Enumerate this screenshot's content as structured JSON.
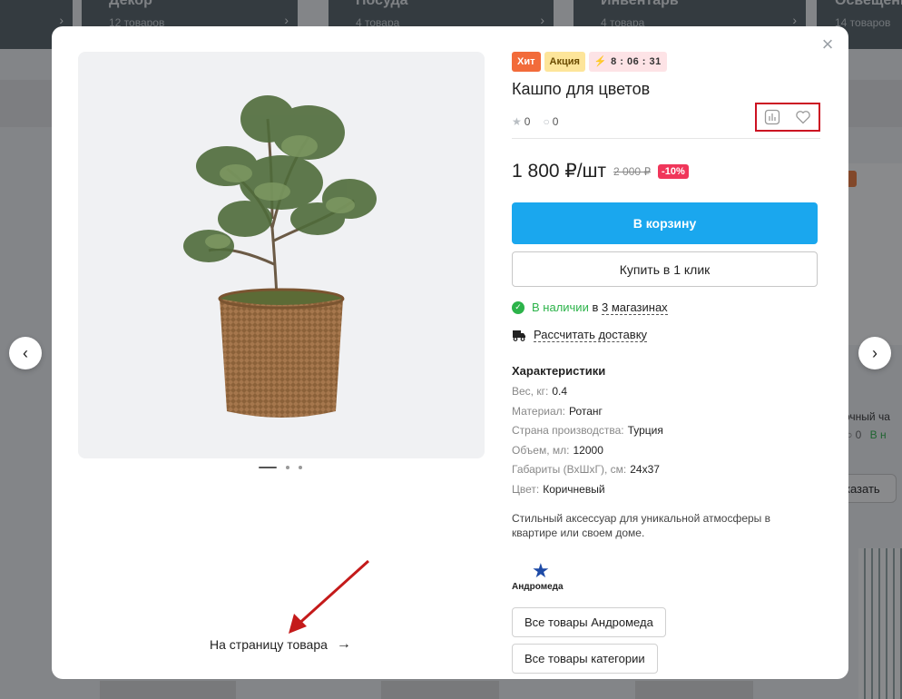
{
  "background": {
    "categories": [
      {
        "name": "Декор",
        "count": "12 товаров"
      },
      {
        "name": "Посуда",
        "count": "4 товара"
      },
      {
        "name": "Инвентарь",
        "count": "4 товара"
      },
      {
        "name": "Освещени",
        "count": "14 товаров"
      }
    ],
    "right_card_title": "очный ча",
    "right_card_rating": "0",
    "right_card_stock": "В н",
    "right_card_button": "казать"
  },
  "nav": {
    "prev_icon": "‹",
    "next_icon": "›"
  },
  "modal": {
    "close_icon": "×",
    "gallery": {
      "image_alt": "Кашпо для цветов",
      "dots_count": 3
    },
    "to_product": {
      "label": "На страницу товара",
      "arrow": "→"
    },
    "badges": {
      "hit": "Хит",
      "promo": "Акция",
      "timer": "8 : 06 : 31"
    },
    "title": "Кашпо для цветов",
    "rating": "0",
    "reviews": "0",
    "price": "1 800 ₽/шт",
    "old_price": "2 000 ₽",
    "discount": "-10%",
    "cart_button": "В корзину",
    "oneclick_button": "Купить в 1 клик",
    "stock": {
      "available": "В наличии",
      "in": "в",
      "stores": "3 магазинах"
    },
    "delivery": "Рассчитать доставку",
    "chars_title": "Характеристики",
    "chars": [
      {
        "k": "Вес, кг:",
        "v": "0.4"
      },
      {
        "k": "Материал:",
        "v": "Ротанг"
      },
      {
        "k": "Страна производства:",
        "v": "Турция"
      },
      {
        "k": "Объем, мл:",
        "v": "12000"
      },
      {
        "k": "Габариты (ВхШхГ), см:",
        "v": "24х37"
      },
      {
        "k": "Цвет:",
        "v": "Коричневый"
      }
    ],
    "description": "Стильный аксессуар для уникальной атмосферы в квартире или своем доме.",
    "brand_name": "Андромеда",
    "brand_button": "Все товары Андромеда",
    "category_button": "Все товары категории"
  },
  "colors": {
    "accent": "#1aa7ee",
    "hit": "#f26b3a",
    "promo": "#fde59a",
    "discount": "#f0365a",
    "stock": "#2cb34a",
    "highlight": "#cc1122"
  }
}
